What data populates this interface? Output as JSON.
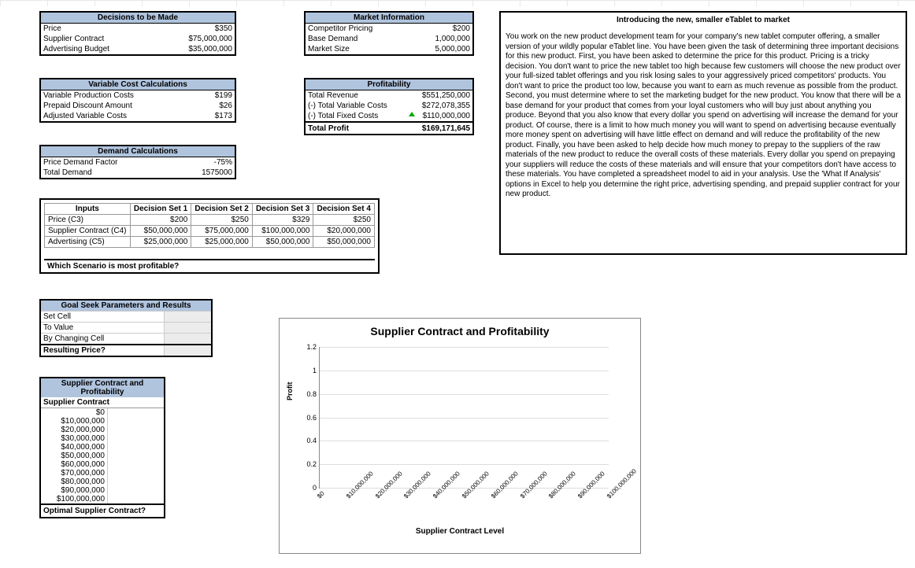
{
  "decisions": {
    "title": "Decisions to be Made",
    "rows": [
      {
        "label": "Price",
        "value": "$350"
      },
      {
        "label": "Supplier Contract",
        "value": "$75,000,000"
      },
      {
        "label": "Advertising Budget",
        "value": "$35,000,000"
      }
    ]
  },
  "varcost": {
    "title": "Variable Cost Calculations",
    "rows": [
      {
        "label": "Variable Production Costs",
        "value": "$199"
      },
      {
        "label": "Prepaid Discount Amount",
        "value": "$26"
      },
      {
        "label": "Adjusted Variable Costs",
        "value": "$173"
      }
    ]
  },
  "demand": {
    "title": "Demand Calculations",
    "rows": [
      {
        "label": "Price Demand Factor",
        "value": "-75%"
      },
      {
        "label": "Total Demand",
        "value": "1575000"
      }
    ]
  },
  "market": {
    "title": "Market Information",
    "rows": [
      {
        "label": "Competitor Pricing",
        "value": "$200"
      },
      {
        "label": "Base Demand",
        "value": "1,000,000"
      },
      {
        "label": "Market Size",
        "value": "5,000,000"
      }
    ]
  },
  "profit": {
    "title": "Profitability",
    "rows": [
      {
        "label": "Total Revenue",
        "value": "$551,250,000"
      },
      {
        "label": "(-) Total Variable Costs",
        "value": "$272,078,355"
      },
      {
        "label": "(-) Total Fixed Costs",
        "value": "$110,000,000"
      }
    ],
    "total_label": "Total Profit",
    "total_value": "$169,171,645"
  },
  "scenario": {
    "headers": [
      "Inputs",
      "Decision Set 1",
      "Decision Set 2",
      "Decision Set 3",
      "Decision Set 4"
    ],
    "rows": [
      {
        "label": "Price (C3)",
        "vals": [
          "$200",
          "$250",
          "$329",
          "$250"
        ]
      },
      {
        "label": "Supplier Contract (C4)",
        "vals": [
          "$50,000,000",
          "$75,000,000",
          "$100,000,000",
          "$20,000,000"
        ]
      },
      {
        "label": "Advertising (C5)",
        "vals": [
          "$25,000,000",
          "$25,000,000",
          "$50,000,000",
          "$50,000,000"
        ]
      }
    ],
    "question": "Which Scenario is most profitable?"
  },
  "goalseek": {
    "title": "Goal Seek Parameters and Results",
    "rows": [
      "Set Cell",
      "To Value",
      "By Changing Cell"
    ],
    "result": "Resulting Price?"
  },
  "suplist": {
    "title": "Supplier Contract and Profitability",
    "subheader": "Supplier Contract",
    "values": [
      "$0",
      "$10,000,000",
      "$20,000,000",
      "$30,000,000",
      "$40,000,000",
      "$50,000,000",
      "$60,000,000",
      "$70,000,000",
      "$80,000,000",
      "$90,000,000",
      "$100,000,000"
    ],
    "question": "Optimal Supplier Contract?"
  },
  "intro": {
    "title": "Introducing the new, smaller eTablet to market",
    "body": "You work on the new product development team for your company's new tablet computer offering, a smaller version of your wildly popular eTablet line. You have been given the task of determining three important decisions for this new product. First, you have been asked to determine the price for this product. Pricing is a tricky decision. You don't want to price the new tablet too high because few customers will choose the new product over your full-sized tablet offerings and you risk losing sales to your aggressively priced competitors' products. You don't want to price the product too low, because you want to earn as much revenue as possible from the product. Second, you must determine where to set the marketing budget for the new product. You know that there will be a base demand for your product that comes from your loyal customers who will buy just about anything you produce. Beyond that you also know that every dollar you spend on advertising will increase the demand for your product. Of course, there is a limit to how much money you will want to spend on advertising because eventually more money spent on advertising will have little effect on demand and will reduce the profitability of the new product. Finally, you have been asked to help decide how much money to prepay to the suppliers of the raw materials of the new product to reduce the overall costs of these materials. Every dollar you spend on prepaying your suppliers will reduce the costs of these materials and will ensure that your competitors don't have access to these materials. You have completed a spreadsheet model to aid in your analysis. Use the 'What If Analysis' options in Excel to help you determine the right price, advertising spending, and prepaid supplier contract for your new product."
  },
  "chart_data": {
    "type": "bar",
    "title": "Supplier Contract and Profitability",
    "xlabel": "Supplier Contract Level",
    "ylabel": "Profit",
    "categories": [
      "$0",
      "$10,000,000",
      "$20,000,000",
      "$30,000,000",
      "$40,000,000",
      "$50,000,000",
      "$60,000,000",
      "$70,000,000",
      "$80,000,000",
      "$90,000,000",
      "$100,000,000"
    ],
    "values": [
      0,
      0,
      0,
      0,
      0,
      0,
      0,
      0,
      0,
      0,
      0
    ],
    "yticks": [
      "0",
      "0.2",
      "0.4",
      "0.6",
      "0.8",
      "1",
      "1.2"
    ],
    "ylim": [
      0,
      1.2
    ]
  }
}
